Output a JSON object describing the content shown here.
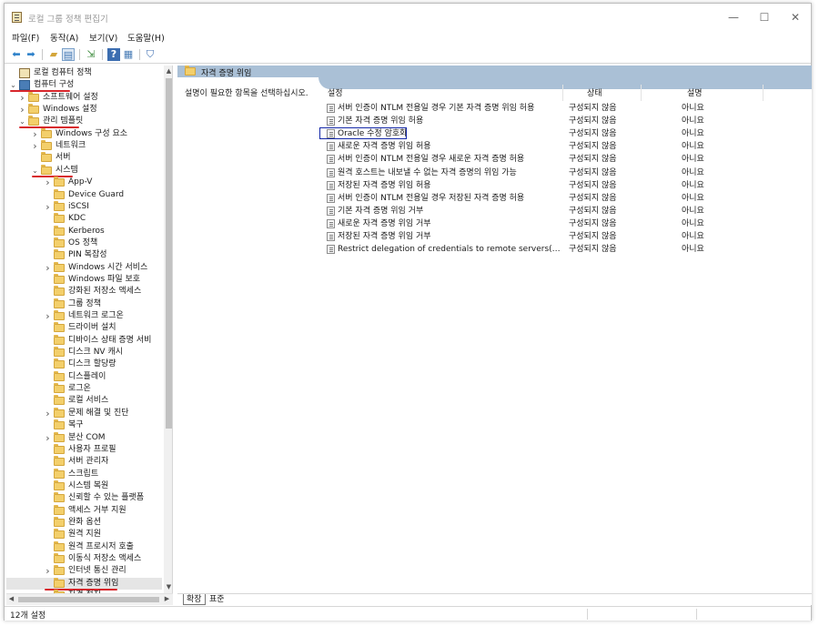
{
  "window": {
    "title": "로컬 그룹 정책 편집기",
    "controls": [
      "—",
      "☐",
      "✕"
    ]
  },
  "menu": [
    "파일(F)",
    "동작(A)",
    "보기(V)",
    "도움말(H)"
  ],
  "toolbar": {
    "icons": [
      "back-arrow-icon",
      "forward-arrow-icon",
      "up-folder-icon",
      "show-hide-tree-icon",
      "export-list-icon",
      "help-icon",
      "properties-icon",
      "filter-icon"
    ]
  },
  "tree": [
    {
      "label": "로컬 컴퓨터 정책",
      "level": 0,
      "chevron": "",
      "icon": "policy"
    },
    {
      "label": "컴퓨터 구성",
      "level": 0,
      "chevron": "v",
      "icon": "computer",
      "underline": true
    },
    {
      "label": "소프트웨어 설정",
      "level": 1,
      "chevron": ">",
      "icon": "folder"
    },
    {
      "label": "Windows 설정",
      "level": 1,
      "chevron": ">",
      "icon": "folder"
    },
    {
      "label": "관리 템플릿",
      "level": 1,
      "chevron": "v",
      "icon": "folder",
      "underline": true
    },
    {
      "label": "Windows 구성 요소",
      "level": 2,
      "chevron": ">",
      "icon": "folder"
    },
    {
      "label": "네트워크",
      "level": 2,
      "chevron": ">",
      "icon": "folder"
    },
    {
      "label": "서버",
      "level": 2,
      "chevron": "",
      "icon": "folder"
    },
    {
      "label": "시스템",
      "level": 2,
      "chevron": "v",
      "icon": "folder",
      "underline": true
    },
    {
      "label": "App-V",
      "level": 3,
      "chevron": ">",
      "icon": "folder"
    },
    {
      "label": "Device Guard",
      "level": 3,
      "chevron": "",
      "icon": "folder"
    },
    {
      "label": "iSCSI",
      "level": 3,
      "chevron": ">",
      "icon": "folder"
    },
    {
      "label": "KDC",
      "level": 3,
      "chevron": "",
      "icon": "folder"
    },
    {
      "label": "Kerberos",
      "level": 3,
      "chevron": "",
      "icon": "folder"
    },
    {
      "label": "OS 정책",
      "level": 3,
      "chevron": "",
      "icon": "folder"
    },
    {
      "label": "PIN 복잡성",
      "level": 3,
      "chevron": "",
      "icon": "folder"
    },
    {
      "label": "Windows 시간 서비스",
      "level": 3,
      "chevron": ">",
      "icon": "folder"
    },
    {
      "label": "Windows 파일 보호",
      "level": 3,
      "chevron": "",
      "icon": "folder"
    },
    {
      "label": "강화된 저장소 액세스",
      "level": 3,
      "chevron": "",
      "icon": "folder"
    },
    {
      "label": "그룹 정책",
      "level": 3,
      "chevron": "",
      "icon": "folder"
    },
    {
      "label": "네트워크 로그온",
      "level": 3,
      "chevron": ">",
      "icon": "folder"
    },
    {
      "label": "드라이버 설치",
      "level": 3,
      "chevron": "",
      "icon": "folder"
    },
    {
      "label": "디바이스 상태 증명 서비",
      "level": 3,
      "chevron": "",
      "icon": "folder"
    },
    {
      "label": "디스크 NV 캐시",
      "level": 3,
      "chevron": "",
      "icon": "folder"
    },
    {
      "label": "디스크 할당량",
      "level": 3,
      "chevron": "",
      "icon": "folder"
    },
    {
      "label": "디스플레이",
      "level": 3,
      "chevron": "",
      "icon": "folder"
    },
    {
      "label": "로그온",
      "level": 3,
      "chevron": "",
      "icon": "folder"
    },
    {
      "label": "로컬 서비스",
      "level": 3,
      "chevron": "",
      "icon": "folder"
    },
    {
      "label": "문제 해결 및 진단",
      "level": 3,
      "chevron": ">",
      "icon": "folder"
    },
    {
      "label": "복구",
      "level": 3,
      "chevron": "",
      "icon": "folder"
    },
    {
      "label": "분산 COM",
      "level": 3,
      "chevron": ">",
      "icon": "folder"
    },
    {
      "label": "사용자 프로필",
      "level": 3,
      "chevron": "",
      "icon": "folder"
    },
    {
      "label": "서버 관리자",
      "level": 3,
      "chevron": "",
      "icon": "folder"
    },
    {
      "label": "스크립트",
      "level": 3,
      "chevron": "",
      "icon": "folder"
    },
    {
      "label": "시스템 복원",
      "level": 3,
      "chevron": "",
      "icon": "folder"
    },
    {
      "label": "신뢰할 수 있는 플랫폼",
      "level": 3,
      "chevron": "",
      "icon": "folder"
    },
    {
      "label": "액세스 거부 지원",
      "level": 3,
      "chevron": "",
      "icon": "folder"
    },
    {
      "label": "완화 옵션",
      "level": 3,
      "chevron": "",
      "icon": "folder"
    },
    {
      "label": "원격 지원",
      "level": 3,
      "chevron": "",
      "icon": "folder"
    },
    {
      "label": "원격 프로시저 호출",
      "level": 3,
      "chevron": "",
      "icon": "folder"
    },
    {
      "label": "이동식 저장소 액세스",
      "level": 3,
      "chevron": "",
      "icon": "folder"
    },
    {
      "label": "인터넷 통신 관리",
      "level": 3,
      "chevron": ">",
      "icon": "folder"
    },
    {
      "label": "자격 증명 위임",
      "level": 3,
      "chevron": "",
      "icon": "folder",
      "selected": true,
      "underline": true
    },
    {
      "label": "자격 접지",
      "level": 3,
      "chevron": "",
      "icon": "folder"
    }
  ],
  "right": {
    "header": "자격 증명 위임",
    "description": "설명이 필요한 항목을 선택하십시오.",
    "columns": {
      "setting": "설정",
      "state": "상태",
      "comment": "설명"
    },
    "rows": [
      {
        "name": "서버 인증이 NTLM 전용일 경우 기본 자격 증명 위임 허용",
        "state": "구성되지 않음",
        "comment": "아니요"
      },
      {
        "name": "기본 자격 증명 위임 허용",
        "state": "구성되지 않음",
        "comment": "아니요"
      },
      {
        "name": "Oracle 수정 암호화",
        "state": "구성되지 않음",
        "comment": "아니요",
        "highlight": true
      },
      {
        "name": "새로운 자격 증명 위임 허용",
        "state": "구성되지 않음",
        "comment": "아니요"
      },
      {
        "name": "서버 인증이 NTLM 전용일 경우 새로운 자격 증명 허용",
        "state": "구성되지 않음",
        "comment": "아니요"
      },
      {
        "name": "원격 호스트는 내보낼 수 없는 자격 증명의 위임 가능",
        "state": "구성되지 않음",
        "comment": "아니요"
      },
      {
        "name": "저장된 자격 증명 위임 허용",
        "state": "구성되지 않음",
        "comment": "아니요"
      },
      {
        "name": "서버 인증이 NTLM 전용일 경우 저장된 자격 증명 허용",
        "state": "구성되지 않음",
        "comment": "아니요"
      },
      {
        "name": "기본 자격 증명 위임 거부",
        "state": "구성되지 않음",
        "comment": "아니요"
      },
      {
        "name": "새로운 자격 증명 위임 거부",
        "state": "구성되지 않음",
        "comment": "아니요"
      },
      {
        "name": "저장된 자격 증명 위임 거부",
        "state": "구성되지 않음",
        "comment": "아니요"
      },
      {
        "name": "Restrict delegation of credentials to remote servers(원격 서...",
        "state": "구성되지 않음",
        "comment": "아니요"
      }
    ]
  },
  "tabs": [
    "확장",
    "표준"
  ],
  "status": "12개 설정",
  "colors": {
    "header_band": "#aac0d6",
    "underline": "#d8262c",
    "highlight_box": "#1428a8",
    "folder": "#f3cf6b"
  }
}
